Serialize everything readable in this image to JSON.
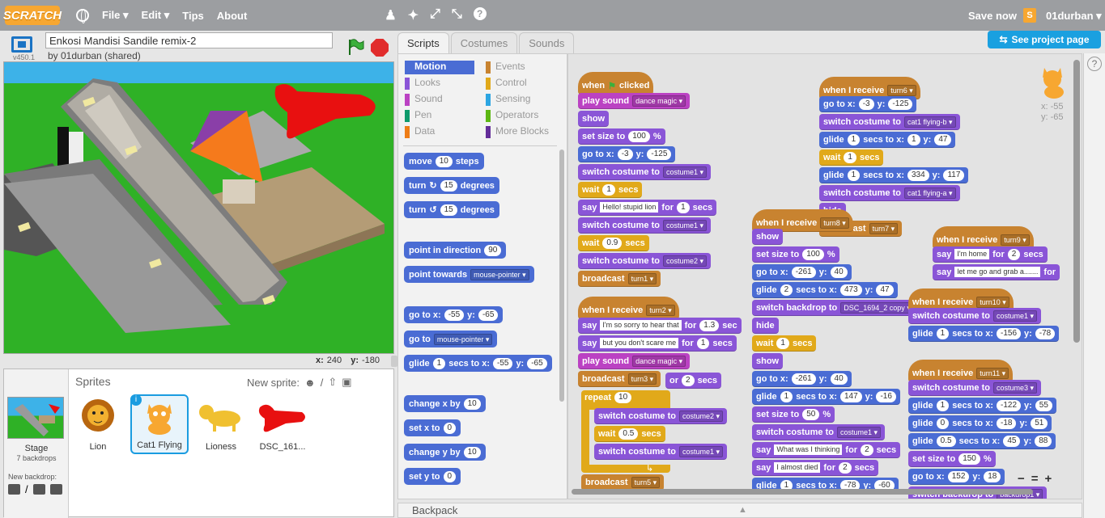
{
  "menubar": {
    "logo": "SCRATCH",
    "menus": [
      "File",
      "Edit",
      "Tips",
      "About"
    ],
    "save_now": "Save now",
    "username": "01durban"
  },
  "stage_header": {
    "version": "v450.1",
    "project_title": "Enkosi Mandisi Sandile remix-2",
    "byline": "by 01durban (shared)"
  },
  "stage_coords": {
    "x_label": "x:",
    "x": "240",
    "y_label": "y:",
    "y": "-180"
  },
  "sprite_pane": {
    "header": "Sprites",
    "new_sprite": "New sprite:",
    "stage_label": "Stage",
    "backdrops": "7 backdrops",
    "new_backdrop": "New backdrop:",
    "sprites": [
      "Lion",
      "Cat1 Flying",
      "Lioness",
      "DSC_161..."
    ]
  },
  "tabs": [
    "Scripts",
    "Costumes",
    "Sounds"
  ],
  "see_project_page": "See project page",
  "categories": [
    {
      "label": "Motion",
      "color": "#4a6cd4"
    },
    {
      "label": "Looks",
      "color": "#8a55d7"
    },
    {
      "label": "Sound",
      "color": "#bb42c3"
    },
    {
      "label": "Pen",
      "color": "#0e9a6c"
    },
    {
      "label": "Data",
      "color": "#ee7d16"
    },
    {
      "label": "Events",
      "color": "#c88330"
    },
    {
      "label": "Control",
      "color": "#e1a91a"
    },
    {
      "label": "Sensing",
      "color": "#2ca5e2"
    },
    {
      "label": "Operators",
      "color": "#5cb712"
    },
    {
      "label": "More Blocks",
      "color": "#632d99"
    }
  ],
  "palette": {
    "move": {
      "a": "move",
      "n": "10",
      "b": "steps"
    },
    "turn_cw": {
      "a": "turn",
      "n": "15",
      "b": "degrees"
    },
    "turn_ccw": {
      "a": "turn",
      "n": "15",
      "b": "degrees"
    },
    "point_dir": {
      "a": "point in direction",
      "n": "90"
    },
    "point_towards": {
      "a": "point towards",
      "d": "mouse-pointer"
    },
    "goto_xy": {
      "a": "go to x:",
      "x": "-55",
      "b": "y:",
      "y": "-65"
    },
    "goto": {
      "a": "go to",
      "d": "mouse-pointer"
    },
    "glide": {
      "a": "glide",
      "n": "1",
      "b": "secs to x:",
      "x": "-55",
      "c": "y:",
      "y": "-65"
    },
    "change_x": {
      "a": "change x by",
      "n": "10"
    },
    "set_x": {
      "a": "set x to",
      "n": "0"
    },
    "change_y": {
      "a": "change y by",
      "n": "10"
    },
    "set_y": {
      "a": "set y to",
      "n": "0"
    }
  },
  "script_sprite_pos": {
    "x": "x: -55",
    "y": "y: -65"
  },
  "scripts": {
    "s1": {
      "hat": {
        "a": "when",
        "b": "clicked"
      },
      "play": {
        "a": "play sound",
        "d": "dance magic"
      },
      "show": "show",
      "size": {
        "a": "set size to",
        "n": "100",
        "b": "%"
      },
      "goto": {
        "a": "go to x:",
        "x": "-3",
        "b": "y:",
        "y": "-125"
      },
      "costume1": {
        "a": "switch costume to",
        "d": "costume1"
      },
      "wait1": {
        "a": "wait",
        "n": "1",
        "b": "secs"
      },
      "say1": {
        "a": "say",
        "t": "Hello! stupid lion",
        "b": "for",
        "n": "1",
        "c": "secs"
      },
      "costume2": {
        "a": "switch costume to",
        "d": "costume1"
      },
      "wait2": {
        "a": "wait",
        "n": "0.9",
        "b": "secs"
      },
      "costume3": {
        "a": "switch costume to",
        "d": "costume2"
      },
      "broadcast": {
        "a": "broadcast",
        "d": "turn1"
      }
    },
    "s2": {
      "hat": {
        "a": "when I receive",
        "d": "turn2"
      },
      "say1": {
        "a": "say",
        "t": "I'm so sorry to hear that",
        "b": "for",
        "n": "1.3",
        "c": "sec"
      },
      "say2": {
        "a": "say",
        "t": "but you don't scare me",
        "b": "for",
        "n": "1",
        "c": "secs"
      },
      "play": {
        "a": "play sound",
        "d": "dance magic"
      },
      "broadcast": {
        "a": "broadcast",
        "d": "turn3"
      },
      "for_frag": {
        "a": "or",
        "n": "2",
        "b": "secs"
      },
      "repeat": {
        "a": "repeat",
        "n": "10"
      },
      "rc1": {
        "a": "switch costume to",
        "d": "costume2"
      },
      "rwait": {
        "a": "wait",
        "n": "0.5",
        "b": "secs"
      },
      "rc2": {
        "a": "switch costume to",
        "d": "costume1"
      },
      "broadcast2": {
        "a": "broadcast",
        "d": "turn5"
      }
    },
    "s3": {
      "hat": {
        "a": "when I receive",
        "d": "turn6"
      },
      "goto": {
        "a": "go to x:",
        "x": "-3",
        "b": "y:",
        "y": "-125"
      },
      "costume1": {
        "a": "switch costume to",
        "d": "cat1 flying-b"
      },
      "glide1": {
        "a": "glide",
        "n": "1",
        "b": "secs to x:",
        "x": "1",
        "c": "y:",
        "y": "47"
      },
      "wait": {
        "a": "wait",
        "n": "1",
        "b": "secs"
      },
      "glide2": {
        "a": "glide",
        "n": "1",
        "b": "secs to x:",
        "x": "334",
        "c": "y:",
        "y": "117"
      },
      "costume2": {
        "a": "switch costume to",
        "d": "cat1 flying-a"
      },
      "hide": "hide",
      "broadcast": {
        "a": "broadcast",
        "d": "turn7"
      }
    },
    "s4": {
      "hat": {
        "a": "when I receive",
        "d": "turn8"
      },
      "show": "show",
      "size": {
        "a": "set size to",
        "n": "100",
        "b": "%"
      },
      "goto": {
        "a": "go to x:",
        "x": "-261",
        "b": "y:",
        "y": "40"
      },
      "glide": {
        "a": "glide",
        "n": "2",
        "b": "secs to x:",
        "x": "473",
        "c": "y:",
        "y": "47"
      },
      "backdrop": {
        "a": "switch backdrop to",
        "d": "DSC_1694_2 copy"
      },
      "hide": "hide",
      "wait": {
        "a": "wait",
        "n": "1",
        "b": "secs"
      },
      "show2": "show",
      "goto2": {
        "a": "go to x:",
        "x": "-261",
        "b": "y:",
        "y": "40"
      },
      "glide2": {
        "a": "glide",
        "n": "1",
        "b": "secs to x:",
        "x": "147",
        "c": "y:",
        "y": "-16"
      },
      "size2": {
        "a": "set size to",
        "n": "50",
        "b": "%"
      },
      "costume": {
        "a": "switch costume to",
        "d": "costume1"
      },
      "say1": {
        "a": "say",
        "t": "What was I thinking",
        "b": "for",
        "n": "2",
        "c": "secs"
      },
      "say2": {
        "a": "say",
        "t": "I almost died",
        "b": "for",
        "n": "2",
        "c": "secs"
      },
      "glide3": {
        "a": "glide",
        "n": "1",
        "b": "secs to x:",
        "x": "-78",
        "c": "y:",
        "y": "-60"
      }
    },
    "s5": {
      "hat": {
        "a": "when I receive",
        "d": "turn9"
      },
      "say1": {
        "a": "say",
        "t": "I'm home",
        "b": "for",
        "n": "2",
        "c": "secs"
      },
      "say2": {
        "a": "say",
        "t": "let me go and grab a.......",
        "b": "for"
      }
    },
    "s6": {
      "hat": {
        "a": "when I receive",
        "d": "turn10"
      },
      "costume": {
        "a": "switch costume to",
        "d": "costume1"
      },
      "glide": {
        "a": "glide",
        "n": "1",
        "b": "secs to x:",
        "x": "-156",
        "c": "y:",
        "y": "-78"
      }
    },
    "s7": {
      "hat": {
        "a": "when I receive",
        "d": "turn11"
      },
      "costume": {
        "a": "switch costume to",
        "d": "costume3"
      },
      "glide1": {
        "a": "glide",
        "n": "1",
        "b": "secs to x:",
        "x": "-122",
        "c": "y:",
        "y": "55"
      },
      "glide2": {
        "a": "glide",
        "n": "0",
        "b": "secs to x:",
        "x": "-18",
        "c": "y:",
        "y": "51"
      },
      "glide3": {
        "a": "glide",
        "n": "0.5",
        "b": "secs to x:",
        "x": "45",
        "c": "y:",
        "y": "88"
      },
      "size": {
        "a": "set size to",
        "n": "150",
        "b": "%"
      },
      "goto": {
        "a": "go to x:",
        "x": "152",
        "b": "y:",
        "y": "18"
      },
      "backdrop": {
        "a": "switch backdrop to",
        "d": "backdrop1"
      }
    }
  },
  "zoom": [
    "−",
    "=",
    "+"
  ],
  "backpack": "Backpack",
  "colors": {
    "motion": "#4a6cd4",
    "looks": "#8a55d7",
    "sound": "#bb42c3",
    "events": "#c88330",
    "control": "#e1a91a",
    "accent": "#1aa0e0",
    "menubar": "#9c9ea1"
  }
}
